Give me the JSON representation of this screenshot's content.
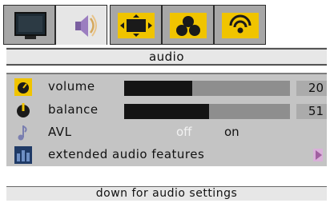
{
  "tabs": [
    {
      "name": "picture",
      "icon": "monitor-icon",
      "active": false
    },
    {
      "name": "audio",
      "icon": "speaker-icon",
      "active": true
    },
    {
      "name": "screen",
      "icon": "screen-format-icon",
      "active": false
    },
    {
      "name": "features",
      "icon": "circles-icon",
      "active": false
    },
    {
      "name": "install",
      "icon": "antenna-icon",
      "active": false
    }
  ],
  "title": "audio",
  "items": [
    {
      "label": "volume",
      "icon": "volume-knob-icon",
      "value": "20",
      "level": 0.41
    },
    {
      "label": "balance",
      "icon": "balance-knob-icon",
      "value": "51",
      "level": 0.51
    },
    {
      "label": "AVL",
      "icon": "avl-note-icon",
      "options": [
        "off",
        "on"
      ],
      "selected": "off"
    },
    {
      "label": "extended audio features",
      "icon": "extended-audio-icon",
      "submenu": true
    }
  ],
  "hint": "down for audio settings",
  "colors": {
    "accent": "#f0c400",
    "panel": "#c4c4c4",
    "bar_fill": "#141414",
    "bar_track": "#8e8e8e",
    "arrow": "#c48fc4"
  }
}
